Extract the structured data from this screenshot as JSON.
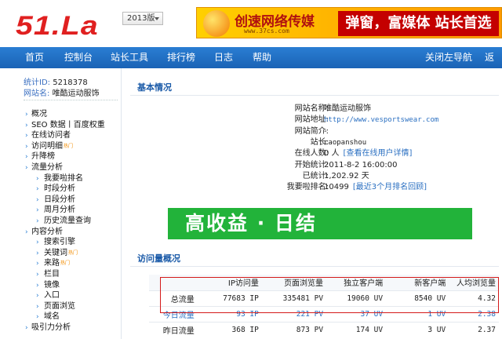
{
  "header": {
    "logo": "51.La",
    "version": "2013版",
    "banner": {
      "text1": "创速网络传媒",
      "text2": "www.37cs.com",
      "text3": "弹窗，富媒体 站长首选"
    }
  },
  "nav": {
    "items": [
      "首页",
      "控制台",
      "站长工具",
      "排行榜",
      "日志",
      "帮助"
    ],
    "right": [
      "关闭左导航",
      "返回"
    ]
  },
  "sidebar": {
    "stat_id_label": "统计ID:",
    "stat_id": "5218378",
    "site_name_label": "网站名:",
    "site_name": "唯酷运动服饰",
    "menu": [
      {
        "label": "概况",
        "level": 1,
        "hot": false
      },
      {
        "label": "SEO 数据丨百度权重",
        "level": 1,
        "hot": false
      },
      {
        "label": "在线访问者",
        "level": 1,
        "hot": false
      },
      {
        "label": "访问明细",
        "level": 1,
        "hot": true
      },
      {
        "label": "升降榜",
        "level": 1,
        "hot": false
      },
      {
        "label": "流量分析",
        "level": 1,
        "hot": false
      },
      {
        "label": "我要啦排名",
        "level": 2,
        "hot": false
      },
      {
        "label": "时段分析",
        "level": 2,
        "hot": false
      },
      {
        "label": "日段分析",
        "level": 2,
        "hot": false
      },
      {
        "label": "周月分析",
        "level": 2,
        "hot": false
      },
      {
        "label": "历史流量查询",
        "level": 2,
        "hot": false
      },
      {
        "label": "内容分析",
        "level": 1,
        "hot": false
      },
      {
        "label": "搜索引擎",
        "level": 2,
        "hot": false
      },
      {
        "label": "关键词",
        "level": 2,
        "hot": true
      },
      {
        "label": "来路",
        "level": 2,
        "hot": true
      },
      {
        "label": "栏目",
        "level": 2,
        "hot": false
      },
      {
        "label": "镜像",
        "level": 2,
        "hot": false
      },
      {
        "label": "入口",
        "level": 2,
        "hot": false
      },
      {
        "label": "页面浏览",
        "level": 2,
        "hot": false
      },
      {
        "label": "域名",
        "level": 2,
        "hot": false
      },
      {
        "label": "吸引力分析",
        "level": 1,
        "hot": false
      }
    ],
    "hot_tag": "热门"
  },
  "basic": {
    "title": "基本情况",
    "rows": [
      {
        "k": "网站名称:",
        "v": "唯酷运动服饰"
      },
      {
        "k": "网站地址:",
        "v": "http://www.vesportswear.com",
        "mono": true
      },
      {
        "k": "网站简介:",
        "v": "-"
      },
      {
        "k": "站长:",
        "v": "caopanshou",
        "mono": true
      },
      {
        "k": "在线人数:",
        "v": "0 人",
        "link": "[查看在线用户详情]"
      },
      {
        "k": "开始统计:",
        "v": "2011-8-2 16:00:00"
      },
      {
        "k": "已统计:",
        "v": "1,202.92 天"
      },
      {
        "k": "我要啦排名:",
        "v": "10499",
        "link": "[最近3个月排名回顾]"
      }
    ]
  },
  "ad_banner": "高收益 · 日结",
  "overview": {
    "title": "访问量概况",
    "headers": [
      "",
      "IP访问量",
      "页面浏览量",
      "独立客户端",
      "新客户端",
      "人均浏览量"
    ],
    "rows": [
      {
        "label": "总流量",
        "cells": [
          "77683 IP",
          "335481 PV",
          "19060 UV",
          "8540 UV",
          "4.32"
        ],
        "cls": "total"
      },
      {
        "label": "今日流量",
        "cells": [
          "93 IP",
          "221 PV",
          "37 UV",
          "1 UV",
          "2.38"
        ],
        "cls": "today"
      },
      {
        "label": "昨日流量",
        "cells": [
          "368 IP",
          "873 PV",
          "174 UV",
          "3 UV",
          "2.37"
        ],
        "cls": "yest"
      }
    ]
  }
}
